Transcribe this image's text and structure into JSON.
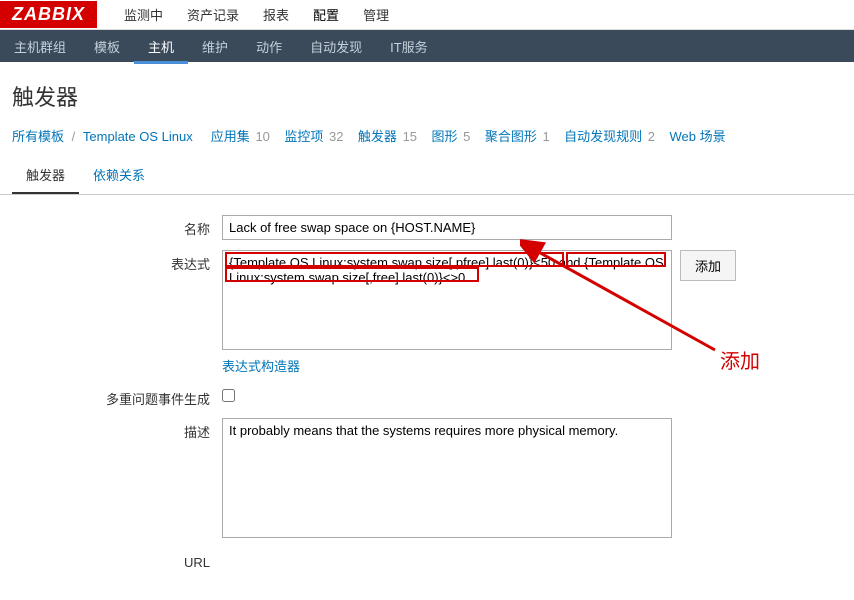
{
  "logo": "ZABBIX",
  "topmenu": {
    "items": [
      "监测中",
      "资产记录",
      "报表",
      "配置",
      "管理"
    ],
    "active_index": 3
  },
  "subbar": {
    "items": [
      "主机群组",
      "模板",
      "主机",
      "维护",
      "动作",
      "自动发现",
      "IT服务"
    ],
    "active_index": 2
  },
  "page_title": "触发器",
  "breadcrumb": {
    "all_templates": "所有模板",
    "template_name": "Template OS Linux",
    "items": [
      {
        "label": "应用集",
        "count": "10"
      },
      {
        "label": "监控项",
        "count": "32"
      },
      {
        "label": "触发器",
        "count": "15",
        "active": true
      },
      {
        "label": "图形",
        "count": "5"
      },
      {
        "label": "聚合图形",
        "count": "1"
      },
      {
        "label": "自动发现规则",
        "count": "2"
      },
      {
        "label": "Web 场景",
        "count": ""
      }
    ]
  },
  "tabs": {
    "items": [
      "触发器",
      "依赖关系"
    ],
    "active_index": 0
  },
  "form": {
    "name_label": "名称",
    "name_value": "Lack of free swap space on {HOST.NAME}",
    "expr_label": "表达式",
    "expr_value": "{Template OS Linux:system.swap.size[,pfree].last(0)}<50 and {Template OS Linux:system.swap.size[,free].last(0)}<>0",
    "add_btn": "添加",
    "expr_builder": "表达式构造器",
    "multi_label": "多重问题事件生成",
    "desc_label": "描述",
    "desc_value": "It probably means that the systems requires more physical memory.",
    "url_label": "URL"
  },
  "annotation": "添加"
}
